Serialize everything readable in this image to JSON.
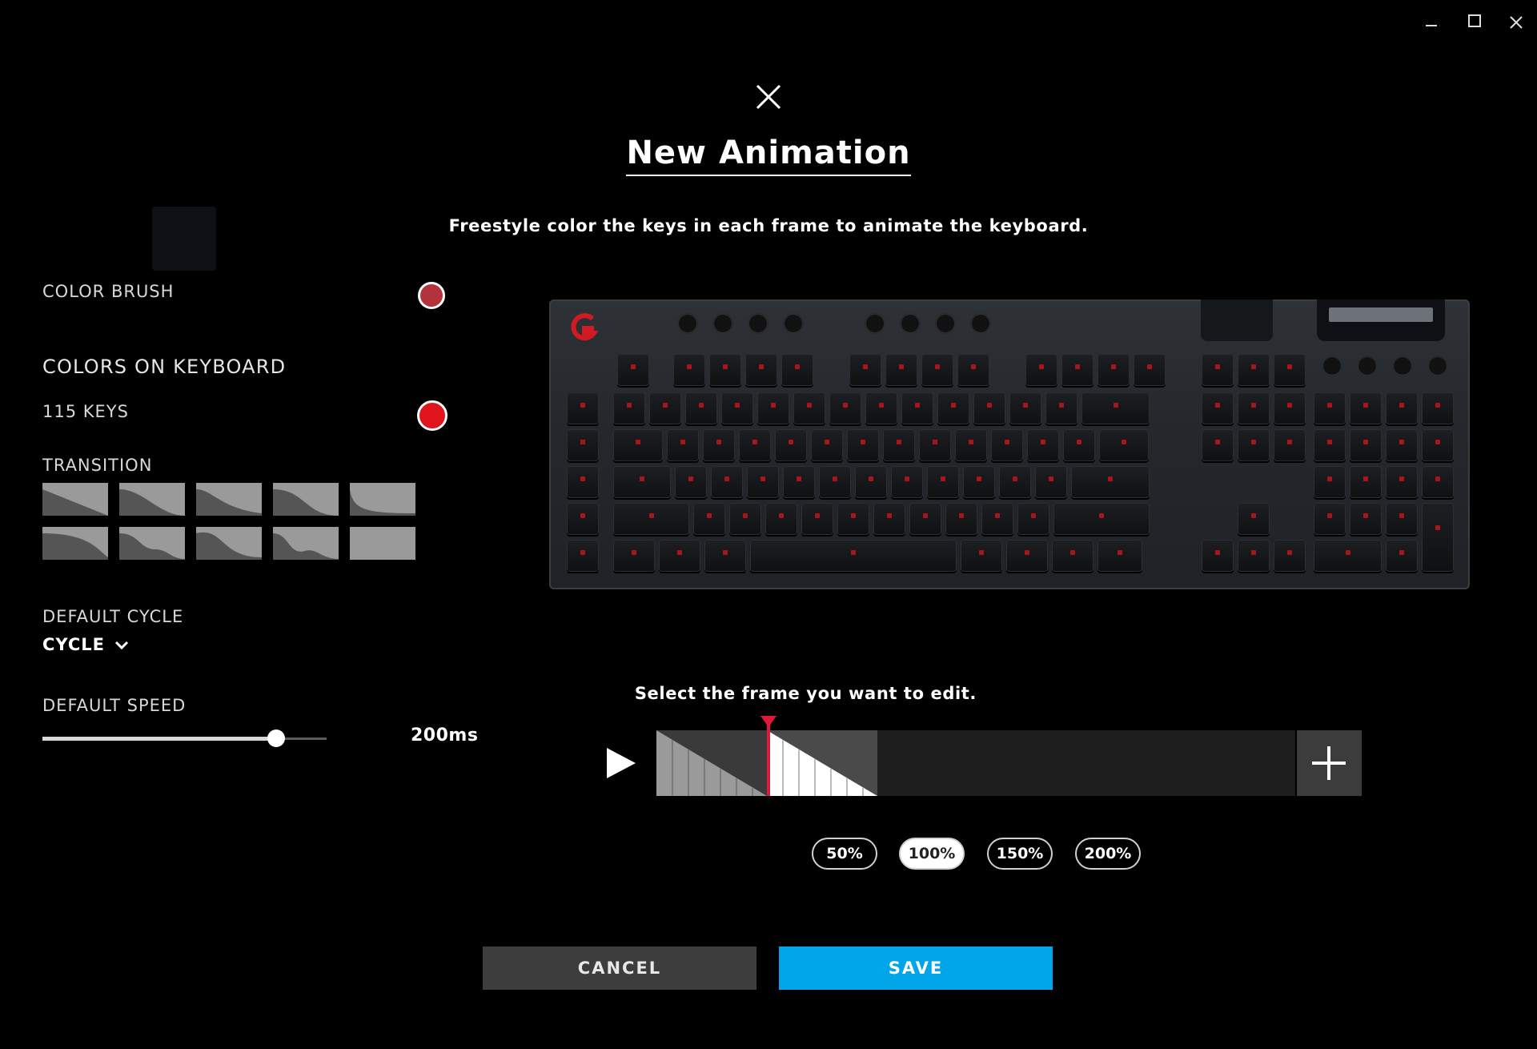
{
  "window": {
    "minimize_icon": "minimize-icon",
    "maximize_icon": "maximize-icon",
    "close_icon": "close-icon"
  },
  "dialog": {
    "title": "New Animation",
    "subtitle": "Freestyle color the keys in each frame to animate the keyboard."
  },
  "left_panel": {
    "color_brush_label": "COLOR BRUSH",
    "color_brush_value": "#b3323b",
    "colors_on_keyboard_label": "COLORS ON KEYBOARD",
    "keys_label": "115 KEYS",
    "keys_color": "#e0141c",
    "transition_label": "TRANSITION",
    "default_cycle_label": "DEFAULT CYCLE",
    "default_cycle_value": "CYCLE",
    "default_speed_label": "DEFAULT SPEED",
    "speed_value": "200ms",
    "speed_fraction": 0.82
  },
  "timeline": {
    "caption": "Select the frame you want to edit.",
    "frames": 2,
    "zoom_options": [
      "50%",
      "100%",
      "150%",
      "200%"
    ],
    "zoom_selected": "100%",
    "playhead_color": "#e0193b"
  },
  "actions": {
    "cancel": "CANCEL",
    "save": "SAVE"
  },
  "colors": {
    "accent": "#00a6e8",
    "key_led": "#c4141a",
    "background": "#000000"
  }
}
